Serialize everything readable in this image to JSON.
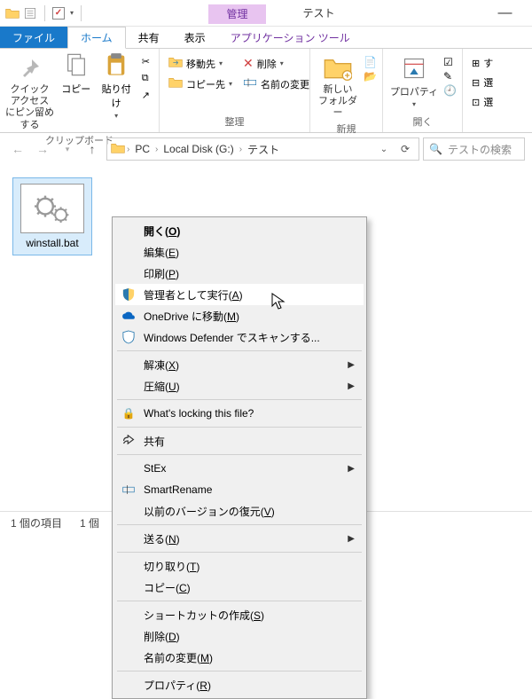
{
  "titlebar": {
    "context_label": "管理",
    "title": "テスト",
    "minimize": "—"
  },
  "tabs": {
    "file": "ファイル",
    "home": "ホーム",
    "share": "共有",
    "view": "表示",
    "app_tools": "アプリケーション ツール"
  },
  "ribbon": {
    "clipboard": {
      "label": "クリップボード",
      "pin": "クイック アクセス\nにピン留めする",
      "copy": "コピー",
      "paste": "貼り付け"
    },
    "organize": {
      "label": "整理",
      "move_to": "移動先",
      "copy_to": "コピー先",
      "delete": "削除",
      "rename": "名前の変更"
    },
    "new": {
      "label": "新規",
      "new_folder": "新しい\nフォルダー"
    },
    "open": {
      "label": "開く",
      "properties": "プロパティ"
    },
    "select": {
      "all": "す",
      "none": "選",
      "invert": "選"
    }
  },
  "address": {
    "crumbs": [
      "PC",
      "Local Disk (G:)",
      "テスト"
    ],
    "search_placeholder": "テストの検索"
  },
  "file": {
    "name": "winstall.bat"
  },
  "statusbar": {
    "count": "1 個の項目",
    "selected": "1 個"
  },
  "context_menu": {
    "open": "開く(O)",
    "edit": "編集(E)",
    "print": "印刷(P)",
    "run_as_admin": "管理者として実行(A)",
    "onedrive": "OneDrive に移動(M)",
    "defender": "Windows Defender でスキャンする...",
    "extract": "解凍(X)",
    "compress": "圧縮(U)",
    "locking": "What's locking this file?",
    "share": "共有",
    "stex": "StEx",
    "smartrename": "SmartRename",
    "prev_versions": "以前のバージョンの復元(V)",
    "send_to": "送る(N)",
    "cut": "切り取り(T)",
    "copy": "コピー(C)",
    "shortcut": "ショートカットの作成(S)",
    "delete": "削除(D)",
    "rename": "名前の変更(M)",
    "properties": "プロパティ(R)"
  }
}
